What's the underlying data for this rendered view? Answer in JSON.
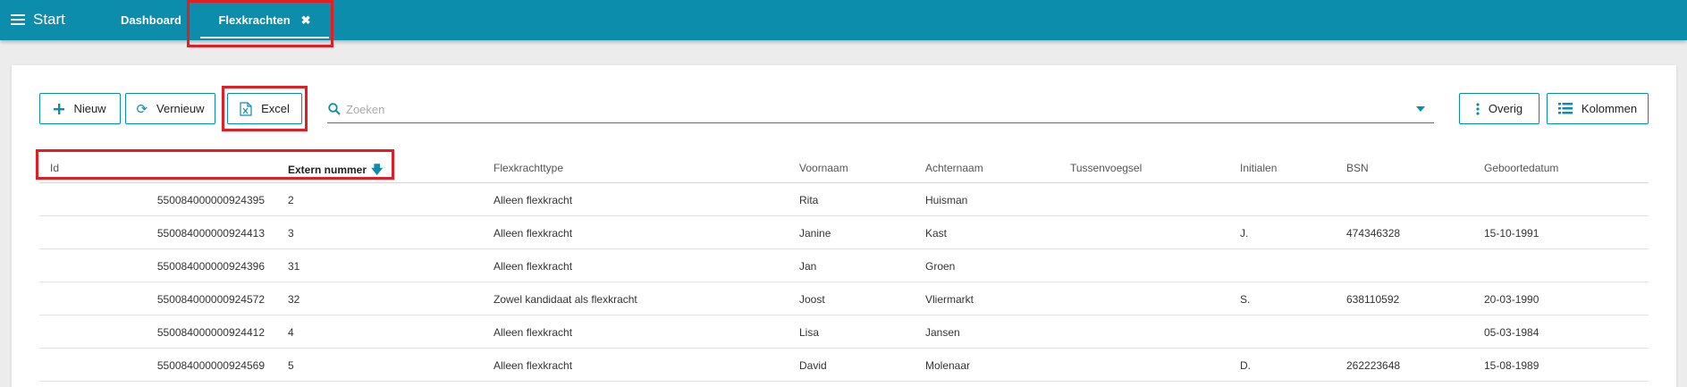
{
  "topbar": {
    "start_label": "Start",
    "tabs": [
      {
        "label": "Dashboard"
      },
      {
        "label": "Flexkrachten",
        "active": true
      }
    ]
  },
  "toolbar": {
    "nieuw_label": "Nieuw",
    "vernieuw_label": "Vernieuw",
    "excel_label": "Excel",
    "overig_label": "Overig",
    "kolommen_label": "Kolommen"
  },
  "search": {
    "placeholder": "Zoeken",
    "value": ""
  },
  "table": {
    "columns": [
      "Id",
      "Extern nummer",
      "Flexkrachttype",
      "Voornaam",
      "Achternaam",
      "Tussenvoegsel",
      "Initialen",
      "BSN",
      "Geboortedatum"
    ],
    "sorted_column": "Extern nummer",
    "sort_direction": "descending-arrow",
    "rows": [
      {
        "id": "550084000000924395",
        "extern": "2",
        "type": "Alleen flexkracht",
        "voornaam": "Rita",
        "achternaam": "Huisman",
        "tussenvoegsel": "",
        "initialen": "",
        "bsn": "",
        "geboortedatum": ""
      },
      {
        "id": "550084000000924413",
        "extern": "3",
        "type": "Alleen flexkracht",
        "voornaam": "Janine",
        "achternaam": "Kast",
        "tussenvoegsel": "",
        "initialen": "J.",
        "bsn": "474346328",
        "geboortedatum": "15-10-1991"
      },
      {
        "id": "550084000000924396",
        "extern": "31",
        "type": "Alleen flexkracht",
        "voornaam": "Jan",
        "achternaam": "Groen",
        "tussenvoegsel": "",
        "initialen": "",
        "bsn": "",
        "geboortedatum": ""
      },
      {
        "id": "550084000000924572",
        "extern": "32",
        "type": "Zowel kandidaat als flexkracht",
        "voornaam": "Joost",
        "achternaam": "Vliermarkt",
        "tussenvoegsel": "",
        "initialen": "S.",
        "bsn": "638110592",
        "geboortedatum": "20-03-1990"
      },
      {
        "id": "550084000000924412",
        "extern": "4",
        "type": "Alleen flexkracht",
        "voornaam": "Lisa",
        "achternaam": "Jansen",
        "tussenvoegsel": "",
        "initialen": "",
        "bsn": "",
        "geboortedatum": "05-03-1984"
      },
      {
        "id": "550084000000924569",
        "extern": "5",
        "type": "Alleen flexkracht",
        "voornaam": "David",
        "achternaam": "Molenaar",
        "tussenvoegsel": "",
        "initialen": "D.",
        "bsn": "262223648",
        "geboortedatum": "15-08-1989"
      }
    ]
  },
  "colors": {
    "accent": "#0b8dab",
    "highlight": "#e31d23",
    "background": "#ececec"
  }
}
